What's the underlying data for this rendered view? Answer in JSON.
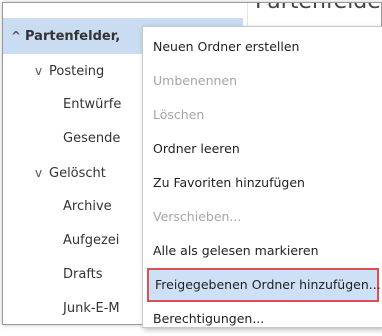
{
  "background_title": "Partenfelde",
  "tree": {
    "root": {
      "label": "Partenfelder,",
      "chevron": "^"
    },
    "items": [
      {
        "label": "Posteing",
        "chevron": "v"
      },
      {
        "label": "Entwürfe",
        "chevron": ""
      },
      {
        "label": "Gesende",
        "chevron": ""
      },
      {
        "label": "Gelöscht",
        "chevron": "v"
      },
      {
        "label": "Archive",
        "chevron": ""
      },
      {
        "label": "Aufgezei",
        "chevron": ""
      },
      {
        "label": "Drafts",
        "chevron": ""
      },
      {
        "label": "Junk-E-M",
        "chevron": ""
      }
    ]
  },
  "context_menu": {
    "items": [
      {
        "label": "Neuen Ordner erstellen",
        "enabled": true
      },
      {
        "label": "Umbenennen",
        "enabled": false
      },
      {
        "label": "Löschen",
        "enabled": false
      },
      {
        "label": "Ordner leeren",
        "enabled": true
      },
      {
        "label": "Zu Favoriten hinzufügen",
        "enabled": true
      },
      {
        "label": "Verschieben...",
        "enabled": false
      },
      {
        "label": "Alle als gelesen markieren",
        "enabled": true
      },
      {
        "label": "Freigegebenen Ordner hinzufügen...",
        "enabled": true,
        "highlighted": true
      },
      {
        "label": "Berechtigungen...",
        "enabled": true
      }
    ]
  },
  "colors": {
    "selection": "#c9dcf1",
    "highlight_border": "#d94f55",
    "disabled_text": "#a6a6a6"
  }
}
